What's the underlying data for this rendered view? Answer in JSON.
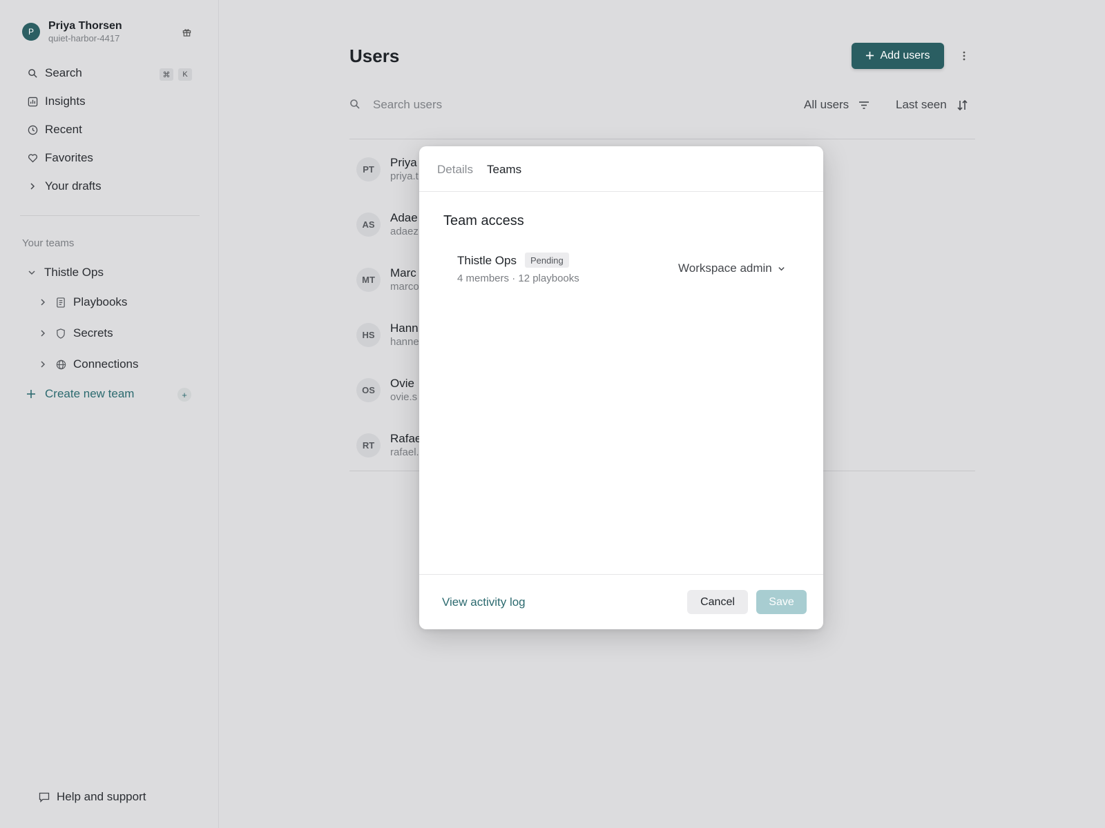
{
  "account": {
    "avatar_initial": "P",
    "name": "Priya Thorsen",
    "workspace": "quiet-harbor-4417"
  },
  "nav": {
    "search": {
      "label": "Search",
      "key1": "⌘",
      "key2": "K"
    },
    "insights": {
      "label": "Insights"
    },
    "recent": {
      "label": "Recent"
    },
    "favorites": {
      "label": "Favorites"
    },
    "drafts": {
      "label": "Your drafts"
    }
  },
  "teams_section": {
    "label": "Your teams",
    "team": "Thistle Ops",
    "children": [
      "Playbooks",
      "Secrets",
      "Connections"
    ],
    "create_label": "Create new team",
    "create_plus": "+"
  },
  "help": {
    "label": "Help and support"
  },
  "main": {
    "title": "Users",
    "add_button": "Add users",
    "search_placeholder": "Search users",
    "filter_label": "All users",
    "sort_label": "Last seen",
    "users": [
      {
        "initials": "PT",
        "name": "Priya",
        "email": "priya.t"
      },
      {
        "initials": "AS",
        "name": "Adae",
        "email": "adaez"
      },
      {
        "initials": "MT",
        "name": "Marc",
        "email": "marco"
      },
      {
        "initials": "HS",
        "name": "Hann",
        "email": "hanne"
      },
      {
        "initials": "OS",
        "name": "Ovie",
        "email": "ovie.s"
      },
      {
        "initials": "RT",
        "name": "Rafae",
        "email": "rafael."
      }
    ]
  },
  "modal": {
    "tabs": [
      "Details",
      "Teams"
    ],
    "active_tab": "Teams",
    "section_title": "Team access",
    "team": {
      "name": "Thistle Ops",
      "status": "Pending",
      "meta": "4 members · 12 playbooks",
      "role": "Workspace admin"
    },
    "activity_link": "View activity log",
    "cancel": "Cancel",
    "save": "Save"
  },
  "colors": {
    "accent": "#2a5e62",
    "link": "#2c6a6f",
    "save_disabled": "#a8cdd1",
    "backdrop": "#dcdcde"
  }
}
